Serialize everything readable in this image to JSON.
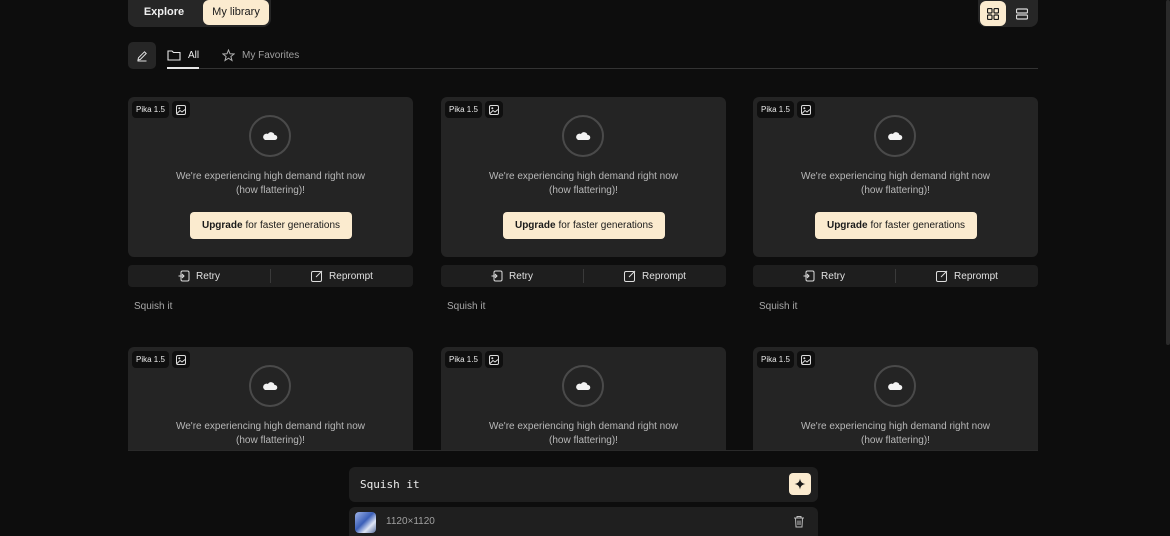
{
  "top_toggle": {
    "explore_label": "Explore",
    "library_label": "My library"
  },
  "tabs": {
    "all_label": "All",
    "favorites_label": "My Favorites"
  },
  "cards": [
    {
      "badge": "Pika 1.5",
      "message": "We're experiencing high demand right now (how flattering)!",
      "upgrade_bold": "Upgrade",
      "upgrade_rest": "for faster generations",
      "retry": "Retry",
      "reprompt": "Reprompt",
      "prompt": "Squish it"
    },
    {
      "badge": "Pika 1.5",
      "message": "We're experiencing high demand right now (how flattering)!",
      "upgrade_bold": "Upgrade",
      "upgrade_rest": "for faster generations",
      "retry": "Retry",
      "reprompt": "Reprompt",
      "prompt": "Squish it"
    },
    {
      "badge": "Pika 1.5",
      "message": "We're experiencing high demand right now (how flattering)!",
      "upgrade_bold": "Upgrade",
      "upgrade_rest": "for faster generations",
      "retry": "Retry",
      "reprompt": "Reprompt",
      "prompt": "Squish it"
    },
    {
      "badge": "Pika 1.5",
      "message": "We're experiencing high demand right now (how flattering)!"
    },
    {
      "badge": "Pika 1.5",
      "message": "We're experiencing high demand right now (how flattering)!"
    },
    {
      "badge": "Pika 1.5",
      "message": "We're experiencing high demand right now (how flattering)!"
    }
  ],
  "composer": {
    "prompt_value": "Squish it",
    "attachment_dims": "1120×1120"
  },
  "colors": {
    "accent": "#fbebcf",
    "background": "#0d0d0d",
    "card": "#242424"
  }
}
